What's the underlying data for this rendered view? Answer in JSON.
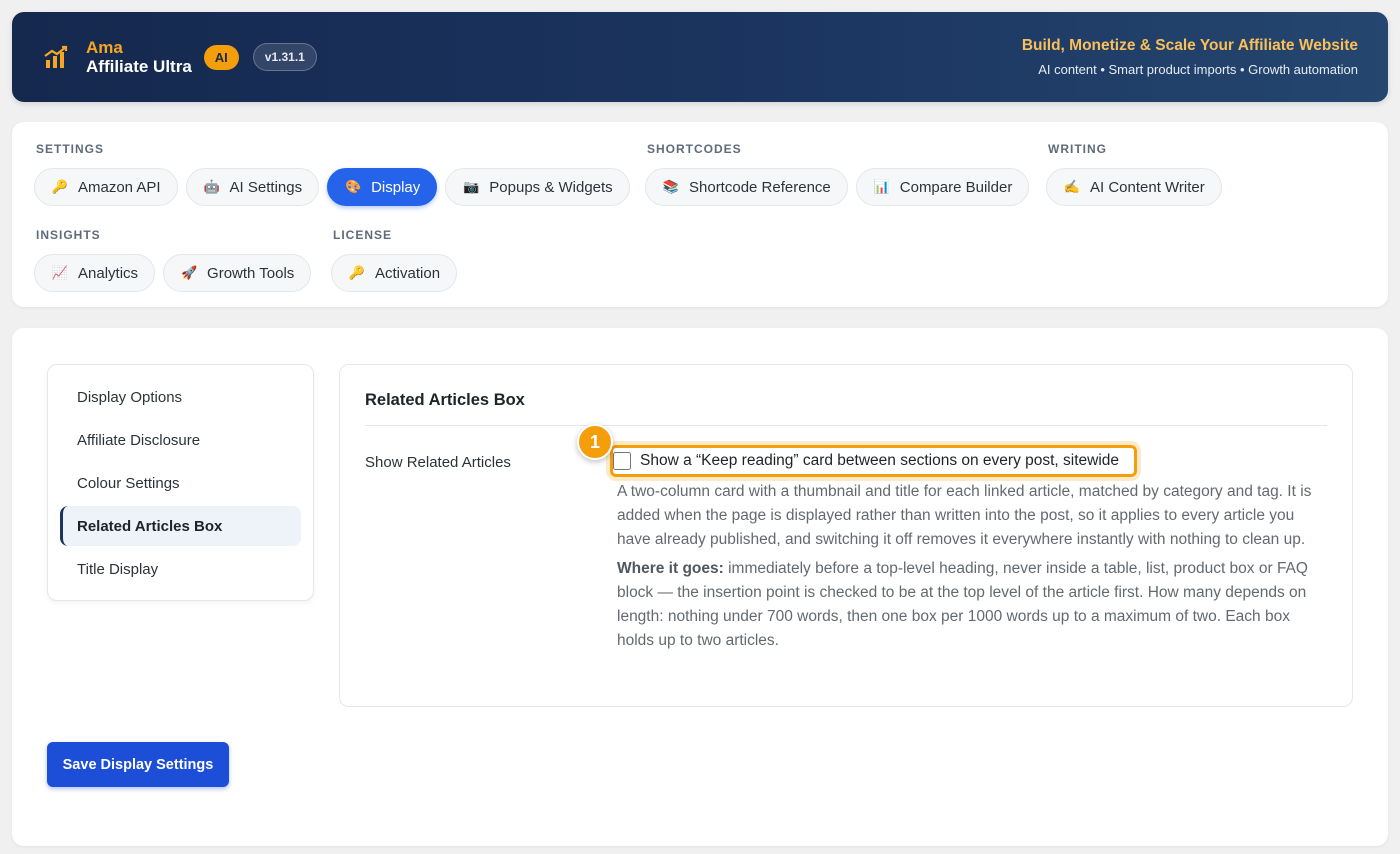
{
  "header": {
    "brand_top": "Ama",
    "brand_bottom": "Affiliate Ultra",
    "ai_badge": "AI",
    "version": "v1.31.1",
    "tagline_title": "Build, Monetize & Scale Your Affiliate Website",
    "tagline_sub": "AI content • Smart product imports • Growth automation"
  },
  "nav": {
    "settings": {
      "label": "SETTINGS",
      "items": [
        {
          "icon": "🔑",
          "label": "Amazon API"
        },
        {
          "icon": "🤖",
          "label": "AI Settings"
        },
        {
          "icon": "🎨",
          "label": "Display"
        },
        {
          "icon": "📷",
          "label": "Popups & Widgets"
        }
      ]
    },
    "shortcodes": {
      "label": "SHORTCODES",
      "items": [
        {
          "icon": "📚",
          "label": "Shortcode Reference"
        },
        {
          "icon": "📊",
          "label": "Compare Builder"
        }
      ]
    },
    "writing": {
      "label": "WRITING",
      "items": [
        {
          "icon": "✍️",
          "label": "AI Content Writer"
        }
      ]
    },
    "insights": {
      "label": "INSIGHTS",
      "items": [
        {
          "icon": "📈",
          "label": "Analytics"
        },
        {
          "icon": "🚀",
          "label": "Growth Tools"
        }
      ]
    },
    "license": {
      "label": "LICENSE",
      "items": [
        {
          "icon": "🔑",
          "label": "Activation"
        }
      ]
    }
  },
  "sidebar": {
    "items": [
      {
        "label": "Display Options"
      },
      {
        "label": "Affiliate Disclosure"
      },
      {
        "label": "Colour Settings"
      },
      {
        "label": "Related Articles Box"
      },
      {
        "label": "Title Display"
      }
    ]
  },
  "panel": {
    "title": "Related Articles Box",
    "field_label": "Show Related Articles",
    "checkbox_label": "Show a “Keep reading” card between sections on every post, sitewide",
    "desc1": "A two-column card with a thumbnail and title for each linked article, matched by category and tag. It is added when the page is displayed rather than written into the post, so it applies to every article you have already published, and switching it off removes it everywhere instantly with nothing to clean up.",
    "desc2_bold": "Where it goes:",
    "desc2": " immediately before a top-level heading, never inside a table, list, product box or FAQ block — the insertion point is checked to be at the top level of the article first. How many depends on length: nothing under 700 words, then one box per 1000 words up to a maximum of two. Each box holds up to two articles."
  },
  "step_badge": "1",
  "save_label": "Save Display Settings",
  "colors": {
    "header_bg": "#15284e",
    "accent_orange": "#f59e0b",
    "primary_blue": "#2563eb"
  }
}
